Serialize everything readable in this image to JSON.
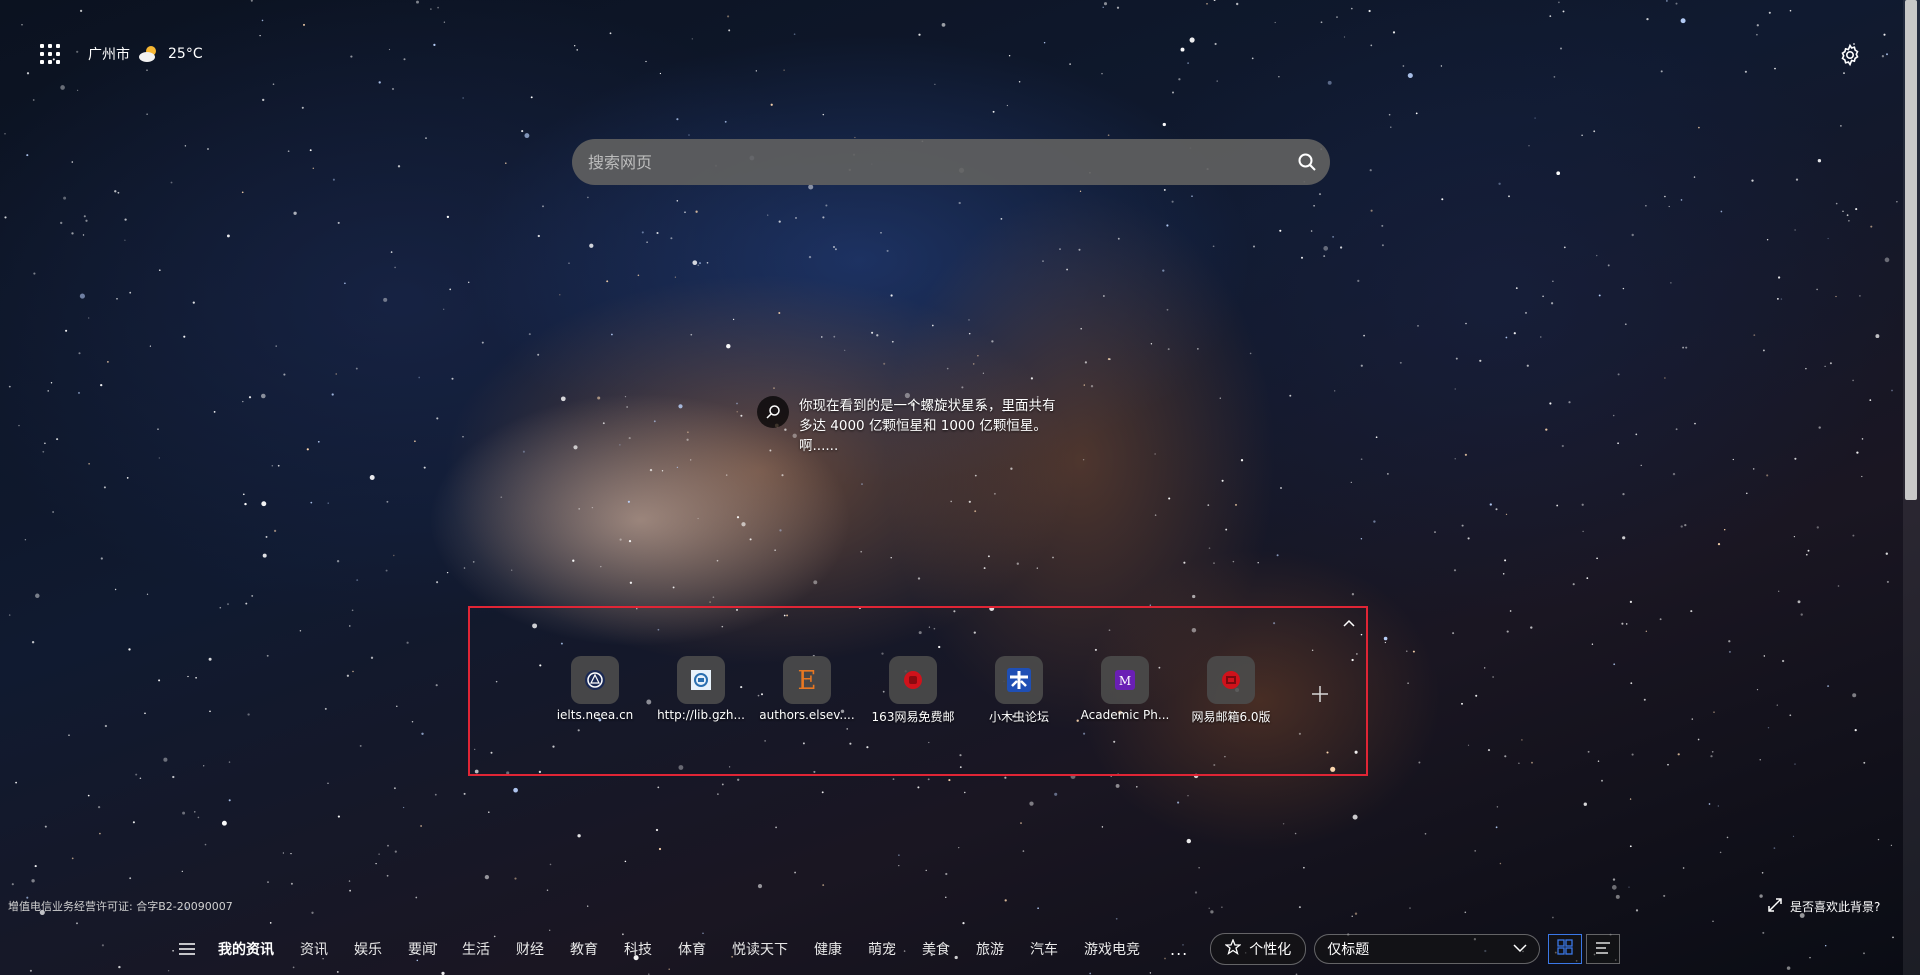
{
  "topbar": {
    "apps_icon": "grid-apps-icon",
    "city": "广州市",
    "weather_icon": "partly-cloudy-icon",
    "temperature": "25°C",
    "settings_icon": "gear-icon"
  },
  "search": {
    "placeholder": "搜索网页",
    "icon": "search-icon"
  },
  "caption": {
    "text": "你现在看到的是一个螺旋状星系，里面共有多达 4000 亿颗恒星和 1000 亿颗恒星。啊......"
  },
  "quick_links": [
    {
      "label": "ielts.neea.cn",
      "icon": "ielts-icon"
    },
    {
      "label": "http://lib.gzh...",
      "icon": "library-icon"
    },
    {
      "label": "authors.elsev....",
      "icon": "elsevier-icon"
    },
    {
      "label": "163网易免费邮",
      "icon": "netease-mail-icon"
    },
    {
      "label": "小木虫论坛",
      "icon": "muchong-icon"
    },
    {
      "label": "Academic Ph...",
      "icon": "academic-icon"
    },
    {
      "label": "网易邮箱6.0版",
      "icon": "netease-mail-6-icon"
    }
  ],
  "colors": {
    "highlight_border": "#e02535",
    "accent_blue": "#3b78e7"
  },
  "footer": {
    "license": "增值电信业务经营许可证: 合字B2-20090007",
    "bg_feedback": "是否喜欢此背景?"
  },
  "nav": {
    "items": [
      "我的资讯",
      "资讯",
      "娱乐",
      "要闻",
      "生活",
      "财经",
      "教育",
      "科技",
      "体育",
      "悦读天下",
      "健康",
      "萌宠",
      "美食",
      "旅游",
      "汽车",
      "游戏电竞"
    ],
    "more": "...",
    "personalize": "个性化",
    "layout_select": "仅标题"
  }
}
